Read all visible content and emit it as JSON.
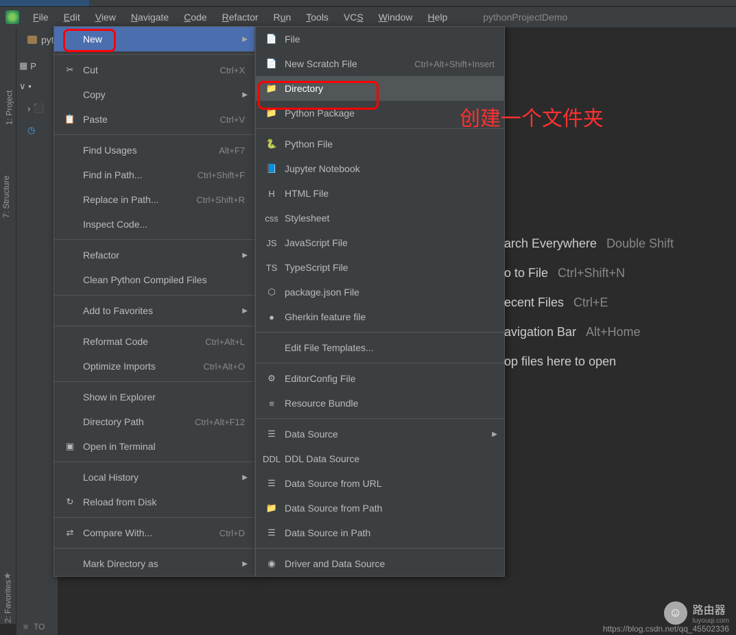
{
  "menubar": {
    "items": [
      "File",
      "Edit",
      "View",
      "Navigate",
      "Code",
      "Refactor",
      "Run",
      "Tools",
      "VCS",
      "Window",
      "Help"
    ],
    "project_name": "pythonProjectDemo"
  },
  "breadcrumb": {
    "label": "pyth"
  },
  "left_rail": {
    "project": "1: Project",
    "structure": "7: Structure",
    "favorites": "2: Favorites"
  },
  "project_tree": {
    "row1": "P",
    "row3": "TO"
  },
  "context_menu": {
    "items": [
      {
        "icon": "",
        "label": "New",
        "shortcut": "",
        "arrow": true,
        "hover": true
      },
      {
        "sep": true
      },
      {
        "icon": "✂",
        "label": "Cut",
        "shortcut": "Ctrl+X"
      },
      {
        "icon": "",
        "label": "Copy",
        "shortcut": "",
        "arrow": true
      },
      {
        "icon": "📋",
        "label": "Paste",
        "shortcut": "Ctrl+V"
      },
      {
        "sep": true
      },
      {
        "icon": "",
        "label": "Find Usages",
        "shortcut": "Alt+F7"
      },
      {
        "icon": "",
        "label": "Find in Path...",
        "shortcut": "Ctrl+Shift+F"
      },
      {
        "icon": "",
        "label": "Replace in Path...",
        "shortcut": "Ctrl+Shift+R"
      },
      {
        "icon": "",
        "label": "Inspect Code...",
        "shortcut": ""
      },
      {
        "sep": true
      },
      {
        "icon": "",
        "label": "Refactor",
        "shortcut": "",
        "arrow": true
      },
      {
        "icon": "",
        "label": "Clean Python Compiled Files",
        "shortcut": ""
      },
      {
        "sep": true
      },
      {
        "icon": "",
        "label": "Add to Favorites",
        "shortcut": "",
        "arrow": true
      },
      {
        "sep": true
      },
      {
        "icon": "",
        "label": "Reformat Code",
        "shortcut": "Ctrl+Alt+L"
      },
      {
        "icon": "",
        "label": "Optimize Imports",
        "shortcut": "Ctrl+Alt+O"
      },
      {
        "sep": true
      },
      {
        "icon": "",
        "label": "Show in Explorer",
        "shortcut": ""
      },
      {
        "icon": "",
        "label": "Directory Path",
        "shortcut": "Ctrl+Alt+F12"
      },
      {
        "icon": "▣",
        "label": "Open in Terminal",
        "shortcut": ""
      },
      {
        "sep": true
      },
      {
        "icon": "",
        "label": "Local History",
        "shortcut": "",
        "arrow": true
      },
      {
        "icon": "↻",
        "label": "Reload from Disk",
        "shortcut": ""
      },
      {
        "sep": true
      },
      {
        "icon": "⇄",
        "label": "Compare With...",
        "shortcut": "Ctrl+D"
      },
      {
        "sep": true
      },
      {
        "icon": "",
        "label": "Mark Directory as",
        "shortcut": "",
        "arrow": true
      }
    ]
  },
  "submenu": {
    "items": [
      {
        "icon": "📄",
        "label": "File",
        "shortcut": ""
      },
      {
        "icon": "📄",
        "label": "New Scratch File",
        "shortcut": "Ctrl+Alt+Shift+Insert"
      },
      {
        "icon": "📁",
        "label": "Directory",
        "shortcut": "",
        "hover": true
      },
      {
        "icon": "📁",
        "label": "Python Package",
        "shortcut": ""
      },
      {
        "sep": true
      },
      {
        "icon": "🐍",
        "label": "Python File",
        "shortcut": ""
      },
      {
        "icon": "📘",
        "label": "Jupyter Notebook",
        "shortcut": ""
      },
      {
        "icon": "H",
        "label": "HTML File",
        "shortcut": ""
      },
      {
        "icon": "css",
        "label": "Stylesheet",
        "shortcut": ""
      },
      {
        "icon": "JS",
        "label": "JavaScript File",
        "shortcut": ""
      },
      {
        "icon": "TS",
        "label": "TypeScript File",
        "shortcut": ""
      },
      {
        "icon": "⬡",
        "label": "package.json File",
        "shortcut": ""
      },
      {
        "icon": "●",
        "label": "Gherkin feature file",
        "shortcut": ""
      },
      {
        "sep": true
      },
      {
        "icon": "",
        "label": "Edit File Templates...",
        "shortcut": ""
      },
      {
        "sep": true
      },
      {
        "icon": "⚙",
        "label": "EditorConfig File",
        "shortcut": ""
      },
      {
        "icon": "≡",
        "label": "Resource Bundle",
        "shortcut": ""
      },
      {
        "sep": true
      },
      {
        "icon": "☰",
        "label": "Data Source",
        "shortcut": "",
        "arrow": true
      },
      {
        "icon": "DDL",
        "label": "DDL Data Source",
        "shortcut": ""
      },
      {
        "icon": "☰",
        "label": "Data Source from URL",
        "shortcut": ""
      },
      {
        "icon": "📁",
        "label": "Data Source from Path",
        "shortcut": ""
      },
      {
        "icon": "☰",
        "label": "Data Source in Path",
        "shortcut": ""
      },
      {
        "sep": true
      },
      {
        "icon": "◉",
        "label": "Driver and Data Source",
        "shortcut": ""
      }
    ]
  },
  "annotation": "创建一个文件夹",
  "welcome": {
    "hints": [
      {
        "label": "arch Everywhere",
        "key": "Double Shift"
      },
      {
        "label": "o to File",
        "key": "Ctrl+Shift+N"
      },
      {
        "label": "ecent Files",
        "key": "Ctrl+E"
      },
      {
        "label": "avigation Bar",
        "key": "Alt+Home"
      },
      {
        "label": "op files here to open",
        "key": ""
      }
    ]
  },
  "watermark": {
    "brand": "路由器",
    "sub": "luyouqi.com"
  },
  "url": "https://blog.csdn.net/qq_45502336",
  "statusbar": {
    "label": "TO"
  }
}
